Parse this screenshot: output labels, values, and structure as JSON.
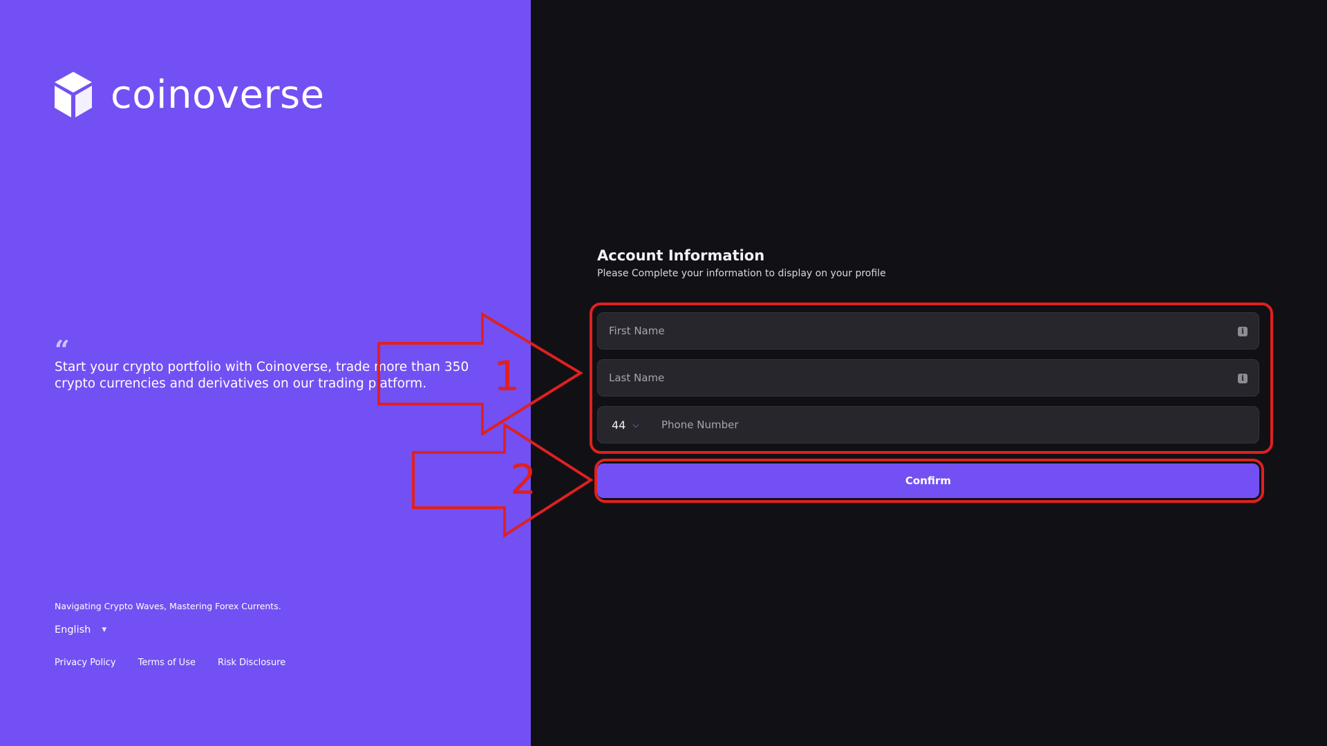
{
  "brand": {
    "name": "coinoverse",
    "quote": "Start your crypto portfolio with Coinoverse, trade more than 350 crypto currencies and derivatives on our trading platform.",
    "tagline": "Navigating Crypto Waves, Mastering Forex Currents.",
    "language": "English",
    "footer_links": {
      "privacy": "Privacy Policy",
      "terms": "Terms of Use",
      "risk": "Risk Disclosure"
    }
  },
  "form": {
    "title": "Account Information",
    "subtitle": "Please Complete your information to display on your profile",
    "first_name_placeholder": "First Name",
    "last_name_placeholder": "Last Name",
    "phone_code": "44",
    "phone_placeholder": "Phone Number",
    "confirm_label": "Confirm"
  },
  "annotations": {
    "step1": "1",
    "step2": "2",
    "color": "#e02020"
  },
  "colors": {
    "brand_purple": "#7350f3",
    "dark_bg": "#111115",
    "field_bg": "#26262c"
  },
  "icons": [
    "coinoverse-logo-icon",
    "quote-icon",
    "dropdown-caret-icon",
    "info-icon",
    "chevron-down-icon"
  ]
}
